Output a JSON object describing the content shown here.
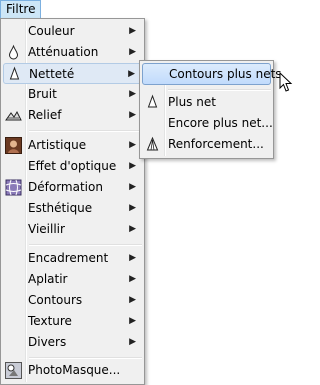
{
  "menubar": {
    "filter_label": "Filtre"
  },
  "menu": {
    "items": [
      {
        "label": "Couleur",
        "icon": "",
        "arrow": "▶"
      },
      {
        "label": "Atténuation",
        "icon": "drop-icon",
        "arrow": "▶"
      },
      {
        "label": "Netteté",
        "icon": "drop-outline-icon",
        "arrow": "▶",
        "state": "open"
      },
      {
        "label": "Bruit",
        "icon": "",
        "arrow": "▶"
      },
      {
        "label": "Relief",
        "icon": "relief-icon",
        "arrow": "▶"
      },
      {
        "label": "Artistique",
        "icon": "portrait-icon",
        "arrow": "▶"
      },
      {
        "label": "Effet d'optique",
        "icon": "",
        "arrow": "▶"
      },
      {
        "label": "Déformation",
        "icon": "grid-warp-icon",
        "arrow": "▶"
      },
      {
        "label": "Esthétique",
        "icon": "",
        "arrow": "▶"
      },
      {
        "label": "Vieillir",
        "icon": "",
        "arrow": "▶"
      },
      {
        "label": "Encadrement",
        "icon": "",
        "arrow": "▶"
      },
      {
        "label": "Aplatir",
        "icon": "",
        "arrow": "▶"
      },
      {
        "label": "Contours",
        "icon": "",
        "arrow": "▶"
      },
      {
        "label": "Texture",
        "icon": "",
        "arrow": "▶"
      },
      {
        "label": "Divers",
        "icon": "",
        "arrow": "▶"
      },
      {
        "label": "PhotoMasque...",
        "icon": "photomask-icon",
        "arrow": ""
      }
    ]
  },
  "submenu": {
    "items": [
      {
        "label": "Contours plus nets",
        "state": "highlighted"
      },
      {
        "label": "Plus net",
        "icon": "drop-outline-icon"
      },
      {
        "label": "Encore plus net..."
      },
      {
        "label": "Renforcement...",
        "icon": "drop-stripes-icon"
      }
    ]
  },
  "colors": {
    "highlight": "#c1dbfc",
    "menu_bg": "#f0f0f0",
    "border": "#979797"
  }
}
